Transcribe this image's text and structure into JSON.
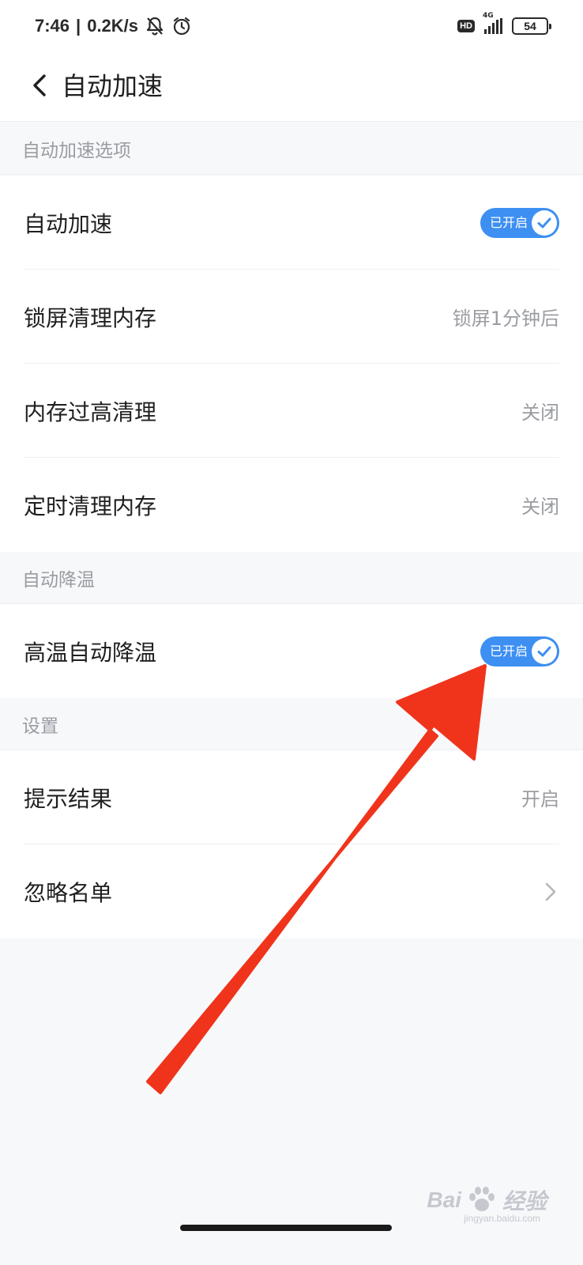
{
  "status_bar": {
    "time": "7:46",
    "separator": "|",
    "net_speed": "0.2K/s",
    "hd_badge": "HD",
    "network_type": "4G",
    "battery": "54"
  },
  "app_bar": {
    "title": "自动加速"
  },
  "sections": {
    "auto_speed": {
      "header": "自动加速选项",
      "rows": {
        "auto_speed": {
          "label": "自动加速",
          "toggle_text": "已开启",
          "on": true
        },
        "lock_clean": {
          "label": "锁屏清理内存",
          "value": "锁屏1分钟后"
        },
        "high_mem_clean": {
          "label": "内存过高清理",
          "value": "关闭"
        },
        "timed_clean": {
          "label": "定时清理内存",
          "value": "关闭"
        }
      }
    },
    "auto_cool": {
      "header": "自动降温",
      "rows": {
        "high_temp_cool": {
          "label": "高温自动降温",
          "toggle_text": "已开启",
          "on": true
        }
      }
    },
    "settings": {
      "header": "设置",
      "rows": {
        "show_result": {
          "label": "提示结果",
          "value": "开启"
        },
        "ignore_list": {
          "label": "忽略名单"
        }
      }
    }
  },
  "watermark": {
    "brand": "Bai",
    "brand_suffix": "经验",
    "domain": "jingyan.baidu.com"
  },
  "colors": {
    "toggle_on": "#3d8ff2",
    "annotation_arrow": "#f0341c",
    "page_background": "#f7f8fa"
  }
}
